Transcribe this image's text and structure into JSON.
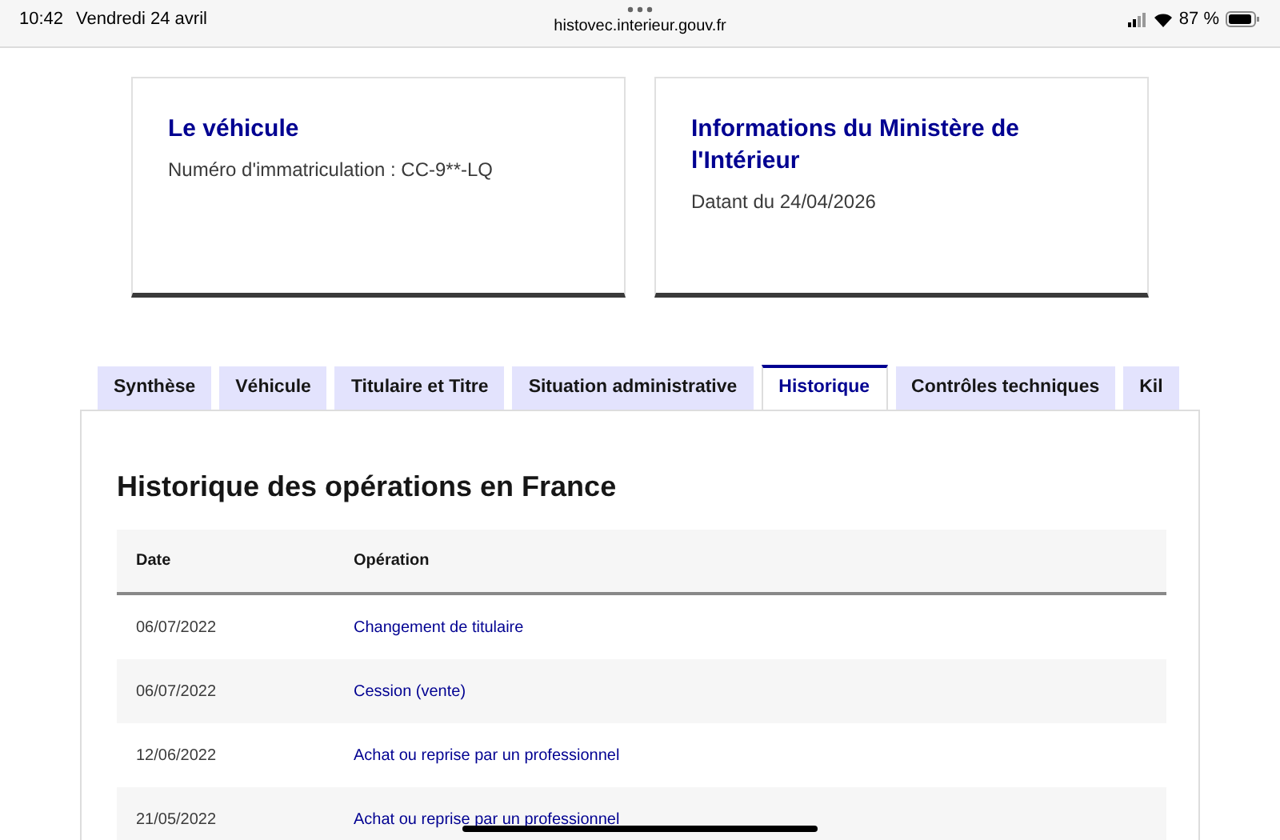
{
  "status_bar": {
    "time": "10:42",
    "date": "Vendredi 24 avril",
    "url": "histovec.interieur.gouv.fr",
    "battery": "87 %"
  },
  "cards": [
    {
      "title": "Le véhicule",
      "text": "Numéro d'immatriculation : CC-9**-LQ"
    },
    {
      "title": "Informations du Ministère de l'Intérieur",
      "text": "Datant du 24/04/2026"
    }
  ],
  "tabs": [
    {
      "label": "Synthèse",
      "selected": false
    },
    {
      "label": "Véhicule",
      "selected": false
    },
    {
      "label": "Titulaire et Titre",
      "selected": false
    },
    {
      "label": "Situation administrative",
      "selected": false
    },
    {
      "label": "Historique",
      "selected": true
    },
    {
      "label": "Contrôles techniques",
      "selected": false
    },
    {
      "label": "Kil",
      "selected": false
    }
  ],
  "section_title": "Historique des opérations en France",
  "table": {
    "columns": [
      "Date",
      "Opération"
    ],
    "rows": [
      [
        "06/07/2022",
        "Changement de titulaire"
      ],
      [
        "06/07/2022",
        "Cession (vente)"
      ],
      [
        "12/06/2022",
        "Achat ou reprise par un professionnel"
      ],
      [
        "21/05/2022",
        "Achat ou reprise par un professionnel"
      ]
    ]
  }
}
